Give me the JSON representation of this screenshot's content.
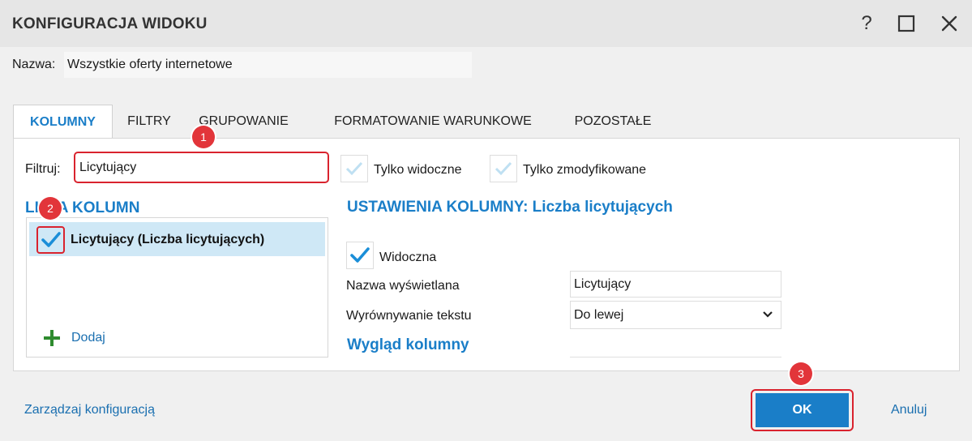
{
  "window": {
    "title": "KONFIGURACJA WIDOKU",
    "help_label": "?"
  },
  "name_field": {
    "label": "Nazwa:",
    "value": "Wszystkie oferty internetowe"
  },
  "tabs": [
    {
      "label": "KOLUMNY",
      "active": true
    },
    {
      "label": "FILTRY",
      "active": false
    },
    {
      "label": "GRUPOWANIE",
      "active": false
    },
    {
      "label": "FORMATOWANIE WARUNKOWE",
      "active": false
    },
    {
      "label": "POZOSTAŁE",
      "active": false
    }
  ],
  "filter": {
    "label": "Filtruj:",
    "value": "Licytujący",
    "only_visible_label": "Tylko widoczne",
    "only_modified_label": "Tylko zmodyfikowane"
  },
  "column_list": {
    "heading": "LISTA KOLUMN",
    "items": [
      {
        "label": "Licytujący (Liczba licytujących)",
        "checked": true
      }
    ],
    "add_label": "Dodaj"
  },
  "column_settings": {
    "heading": "USTAWIENIA KOLUMNY: Liczba licytujących",
    "visible_label": "Widoczna",
    "visible_checked": true,
    "display_name_label": "Nazwa wyświetlana",
    "display_name_value": "Licytujący",
    "alignment_label": "Wyrównywanie tekstu",
    "alignment_value": "Do lewej",
    "look_heading": "Wygląd kolumny"
  },
  "footer": {
    "manage_label": "Zarządzaj konfiguracją",
    "ok_label": "OK",
    "cancel_label": "Anuluj"
  },
  "badges": [
    "1",
    "2",
    "3"
  ],
  "colors": {
    "accent": "#1a7ec8",
    "highlight": "#d9232e",
    "badge": "#e2353a",
    "selection": "#cfe8f6",
    "add_green": "#2e8b2e"
  }
}
